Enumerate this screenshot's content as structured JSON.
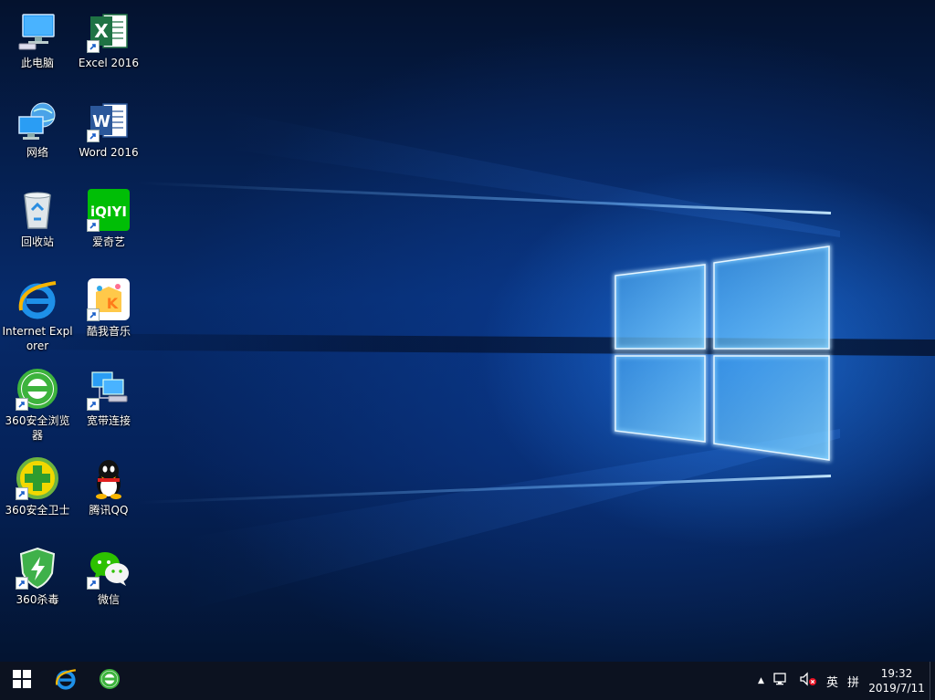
{
  "desktop": {
    "icons_left": [
      {
        "name": "this-pc",
        "label": "此电脑",
        "icon": "computer-icon",
        "shortcut": false
      },
      {
        "name": "network",
        "label": "网络",
        "icon": "network-icon",
        "shortcut": false
      },
      {
        "name": "recycle-bin",
        "label": "回收站",
        "icon": "recycle-bin-icon",
        "shortcut": false
      },
      {
        "name": "internet-explorer",
        "label": "Internet Explorer",
        "icon": "ie-icon",
        "shortcut": false
      },
      {
        "name": "360-browser",
        "label": "360安全浏览器",
        "icon": "360-browser-icon",
        "shortcut": true
      },
      {
        "name": "360-safeguard",
        "label": "360安全卫士",
        "icon": "360-safeguard-icon",
        "shortcut": true
      },
      {
        "name": "360-antivirus",
        "label": "360杀毒",
        "icon": "360-antivirus-icon",
        "shortcut": true
      }
    ],
    "icons_right": [
      {
        "name": "excel-2016",
        "label": "Excel 2016",
        "icon": "excel-icon",
        "shortcut": true
      },
      {
        "name": "word-2016",
        "label": "Word 2016",
        "icon": "word-icon",
        "shortcut": true
      },
      {
        "name": "iqiyi",
        "label": "爱奇艺",
        "icon": "iqiyi-icon",
        "shortcut": true
      },
      {
        "name": "kuwo-music",
        "label": "酷我音乐",
        "icon": "kuwo-icon",
        "shortcut": true
      },
      {
        "name": "broadband",
        "label": "宽带连接",
        "icon": "broadband-icon",
        "shortcut": true
      },
      {
        "name": "tencent-qq",
        "label": "腾讯QQ",
        "icon": "qq-icon",
        "shortcut": true
      },
      {
        "name": "wechat",
        "label": "微信",
        "icon": "wechat-icon",
        "shortcut": true
      }
    ],
    "iqiyi_logo_text": "iQIYI",
    "excel_letter": "X",
    "word_letter": "W",
    "kuwo_letter": "K"
  },
  "taskbar": {
    "pinned": [
      {
        "name": "start",
        "icon": "windows-start-icon"
      },
      {
        "name": "ie",
        "icon": "ie-icon"
      },
      {
        "name": "360-browser",
        "icon": "360-browser-icon"
      }
    ],
    "tray": {
      "chevron": "▲",
      "ime_lang": "英",
      "ime_mode": "拼"
    },
    "clock": {
      "time": "19:32",
      "date": "2019/7/11"
    }
  },
  "colors": {
    "taskbar_bg": "#0c1220",
    "excel_green": "#1f7244",
    "word_blue": "#2b579a",
    "iqiyi_green": "#00be06",
    "qq_black": "#111111",
    "wechat_green": "#2dc100"
  }
}
